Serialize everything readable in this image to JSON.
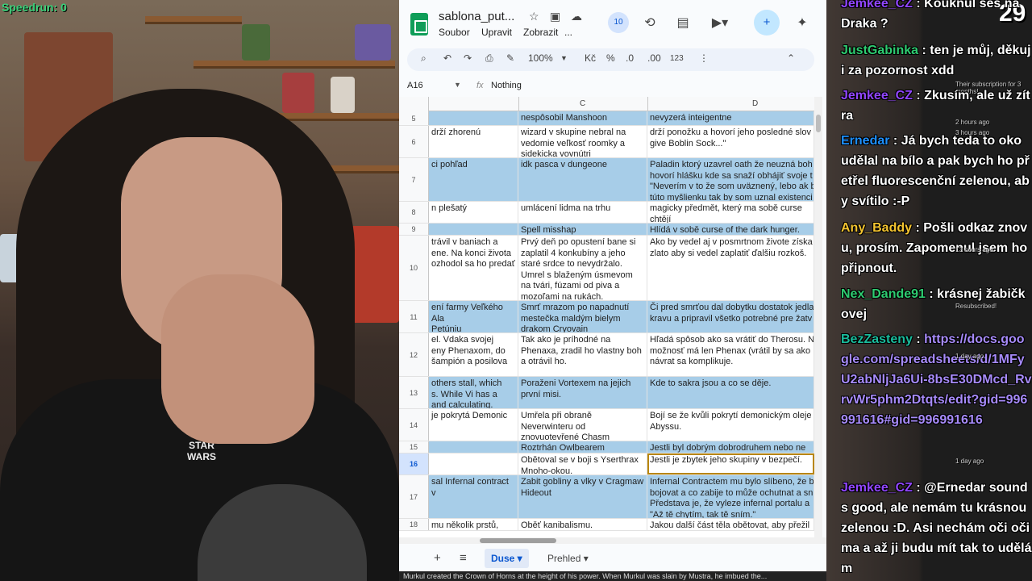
{
  "webcam": {
    "overlay_text": "Speedrun: 0",
    "shirt_text": "STAR WARS"
  },
  "sheets": {
    "doc_title": "sablona_put...",
    "menu": [
      "Soubor",
      "Upravit",
      "Zobrazit",
      "..."
    ],
    "collaborators_badge": "10",
    "toolbar": {
      "zoom": "100%",
      "currency": "Kč",
      "percent": "%",
      "decimal_decrease": ".0",
      "decimal_increase": ".00",
      "number_format": "123"
    },
    "name_box": "A16",
    "formula": "Nothing",
    "columns": [
      "C",
      "D"
    ],
    "rows": [
      {
        "num": "5",
        "color": "blue",
        "b": "",
        "c": "nespôsobil Manshoon",
        "d": "nevyzerá inteigentne"
      },
      {
        "num": "6",
        "color": "white",
        "b": "drží zhorenú",
        "c": "wizard v skupine nebral na\nvedomie veľkosť roomky a\nsidekicka vovnútri",
        "d": "drží ponožku a hovorí jeho posledné slov\ngive Boblin Sock...\""
      },
      {
        "num": "7",
        "color": "blue",
        "b": "ci pohľad",
        "c": "idk pasca v dungeone",
        "d": "Paladin ktorý uzavrel oath že neuzná boh\nhovorí hlášku kde sa snaží obhájiť svoje t\n\"Neverím v to že som uväznený, lebo ak b\ntúto myšlienku tak by som uznal existenci"
      },
      {
        "num": "8",
        "color": "white",
        "b": "n plešatý",
        "c": "umlácení lidma na trhu",
        "d": "magicky předmět, který ma sobě curse\nchtějí"
      },
      {
        "num": "9",
        "color": "blue",
        "b": "",
        "c": "Spell misshap",
        "d": "Hlídá v sobě curse of the dark hunger."
      },
      {
        "num": "10",
        "color": "white",
        "b": "trávil v baniach a\nene. Na konci života\nozhodol sa ho predať",
        "c": "Prvý deň po opustení bane si\nzaplatil 4 konkubíny a jeho\nstaré srdce to nevydržalo.\nUmrel s blaženým úsmevom\nna tvári, fúzami od piva a\nmozoľami na rukách.",
        "d": "Ako by vedel aj v posmrtnom živote získa\nzlato aby si vedel zaplatiť ďalšiu rozkoš."
      },
      {
        "num": "11",
        "color": "blue",
        "b": "ení farmy Veľkého Ala\nPetúniu",
        "c": "Smrť mrazom po napadnutí\nmestečka maldým bielym\ndrakom Cryovain",
        "d": "Či pred smrťou dal dobytku dostatok jedla\nkravu a pripravil všetko potrebné pre žatv"
      },
      {
        "num": "12",
        "color": "white",
        "b": "el. Vdaka svojej\neny Phenaxom, do\nšampión a posilova",
        "c": "Tak ako je príhodné na\nPhenaxa, zradil ho vlastny boh\na otrávil ho.",
        "d": "Hľadá spôsob ako sa vrátiť do Therosu. N\nmožnosť má len Phenax (vrátil by sa ako\nnávrat sa komplikuje."
      },
      {
        "num": "13",
        "color": "blue",
        "b": "others stall, which\ns. While Vi has a\nand calculating.",
        "c": "Poraženi Vortexem na jejich\nprvní misi.",
        "d": "Kde to sakra jsou a co se děje."
      },
      {
        "num": "14",
        "color": "white",
        "b": "je pokrytá Demonic",
        "c": "Umřela při obraně\nNeverwinteru od\nznovuotevřené Chasm",
        "d": "Bojí se že kvůli pokrytí demonickým oleje\nAbyssu."
      },
      {
        "num": "15",
        "color": "blue",
        "b": "",
        "c": "Roztrhán Owlbearem",
        "d": "Jestli byl dobrým dobrodruhem nebo ne"
      },
      {
        "num": "16",
        "color": "white",
        "b": "",
        "c": "Obětoval se v boji s Yserthrax\nMnoho-okou.",
        "d": "Jestli je zbytek jeho skupiny v bezpečí."
      },
      {
        "num": "17",
        "color": "blue",
        "b": "sal Infernal contract v",
        "c": "Zabit gobliny a vlky v Cragmaw\nHideout",
        "d": "Infernal Contractem mu bylo slíbeno, že b\nbojovat a co zabije to může ochutnat a sn\nPředstava je, že vyleze infernal portalu a\n\"Až tě chytím, tak tě sním.\""
      },
      {
        "num": "18",
        "color": "white",
        "b": "mu několik prstů,",
        "c": "Oběť kanibalismu.",
        "d": "Jakou další část těla obětovat, aby přežil"
      }
    ],
    "tabs": [
      "Duse",
      "Prehled"
    ],
    "bottom_text": "Murkul created the Crown of Horns at the height of his power. When Murkul was slain by Mustra, he imbued the..."
  },
  "chat": {
    "count": "29",
    "messages": [
      {
        "user": "Jemkee_CZ",
        "user_color": "#9146ff",
        "text": "Kouknul ses na Draka ?"
      },
      {
        "user": "JustGabinka",
        "user_color": "#2ecc71",
        "text": "ten je můj, děkuji za pozornost xdd",
        "meta": "Their subscription for 3 months!"
      },
      {
        "user": "Jemkee_CZ",
        "user_color": "#9146ff",
        "text": "Zkusím, ale už zítra",
        "meta": "2 hours ago"
      },
      {
        "user": "Ernedar",
        "user_color": "#1e90ff",
        "text": "Já bych teda to oko udělal na bílo a pak bych ho přetřel fluorescenční zelenou, aby svítilo :-P",
        "meta": "3 hours ago"
      },
      {
        "user": "Any_Baddy",
        "user_color": "#f4c430",
        "text": "Pošli odkaz znovu, prosím. Zapomenul jsem ho připnout.",
        "meta": "13 hours ago"
      },
      {
        "user": "Nex_Dande91",
        "user_color": "#2ecc71",
        "text": "krásnej žabičkovej",
        "meta": "Resubscribed!"
      },
      {
        "user": "BezZasteny",
        "user_color": "#1abc9c",
        "text": "https://docs.google.com/spreadsheets/d/1MFyU2abNljJa6Ui-8bsE30DMcd_RvrvWr5phm2Dtqts/edit?gid=996991616#gid=996991616",
        "meta": "1 day ago"
      },
      {
        "user": "Jemkee_CZ",
        "user_color": "#9146ff",
        "text": "@Ernedar sounds good, ale nemám tu krásnou zelenou :D. Asi nechám oči očima a až ji budu mít tak to udělám",
        "meta": "1 day ago"
      }
    ]
  }
}
